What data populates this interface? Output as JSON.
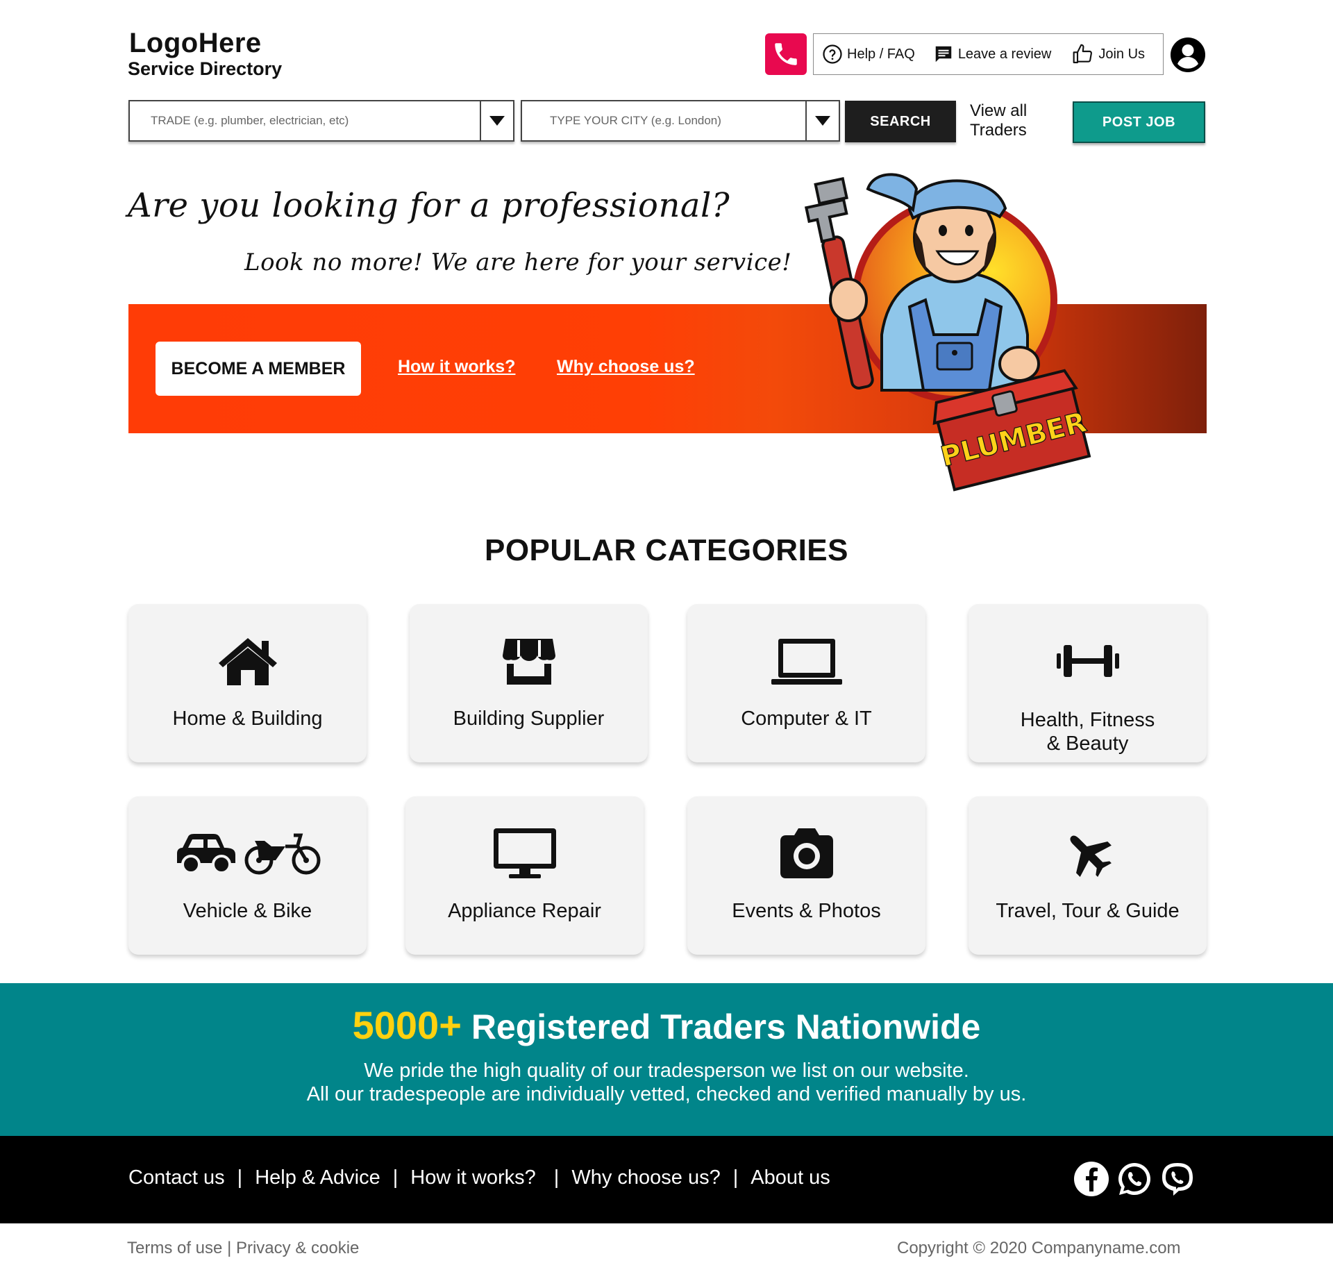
{
  "logo": {
    "main": "LogoHere",
    "sub": "Service Directory"
  },
  "topnav": {
    "help": "Help / FAQ",
    "review": "Leave a review",
    "join": "Join Us"
  },
  "search": {
    "trade_placeholder": "TRADE (e.g. plumber, electrician, etc)",
    "city_placeholder": "TYPE YOUR CITY (e.g. London)",
    "search_label": "SEARCH",
    "view_all": "View all Traders",
    "post_job": "POST JOB"
  },
  "hero": {
    "title": "Are you looking for a professional?",
    "subtitle": "Look no more! We are here for your service!",
    "member_button": "BECOME A MEMBER",
    "how_link": "How it works?",
    "why_link": "Why choose us?",
    "mascot_text": "PLUMBER"
  },
  "categories": {
    "heading": "POPULAR CATEGORIES",
    "items": [
      {
        "label": "Home & Building",
        "icon": "home-icon"
      },
      {
        "label": "Building Supplier",
        "icon": "store-icon"
      },
      {
        "label": "Computer & IT",
        "icon": "laptop-icon"
      },
      {
        "label_line1": "Health, Fitness",
        "label_line2": "& Beauty",
        "icon": "dumbbell-icon"
      },
      {
        "label": "Vehicle & Bike",
        "icon": "car-motorbike-icon"
      },
      {
        "label": "Appliance Repair",
        "icon": "monitor-icon"
      },
      {
        "label": "Events & Photos",
        "icon": "camera-icon"
      },
      {
        "label": "Travel, Tour & Guide",
        "icon": "airplane-icon"
      }
    ]
  },
  "stats": {
    "count": "5000+",
    "title": "Registered Traders Nationwide",
    "line1": "We pride the high quality of our tradesperson we list on our website.",
    "line2": "All our tradespeople are individually vetted, checked and verified manually by us."
  },
  "footer": {
    "links": [
      "Contact us",
      "Help & Advice",
      "How it works?",
      "Why choose us?",
      "About us"
    ],
    "separator": "|",
    "terms": "Terms of use",
    "privacy": "Privacy & cookie",
    "copyright": "Copyright © 2020 Companyname.com"
  },
  "colors": {
    "phone_accent": "#e8094f",
    "post_job": "#0e9b8c",
    "hero_banner": "#ff3c06",
    "stats_band": "#01858a",
    "stats_number": "#ffd10f"
  }
}
